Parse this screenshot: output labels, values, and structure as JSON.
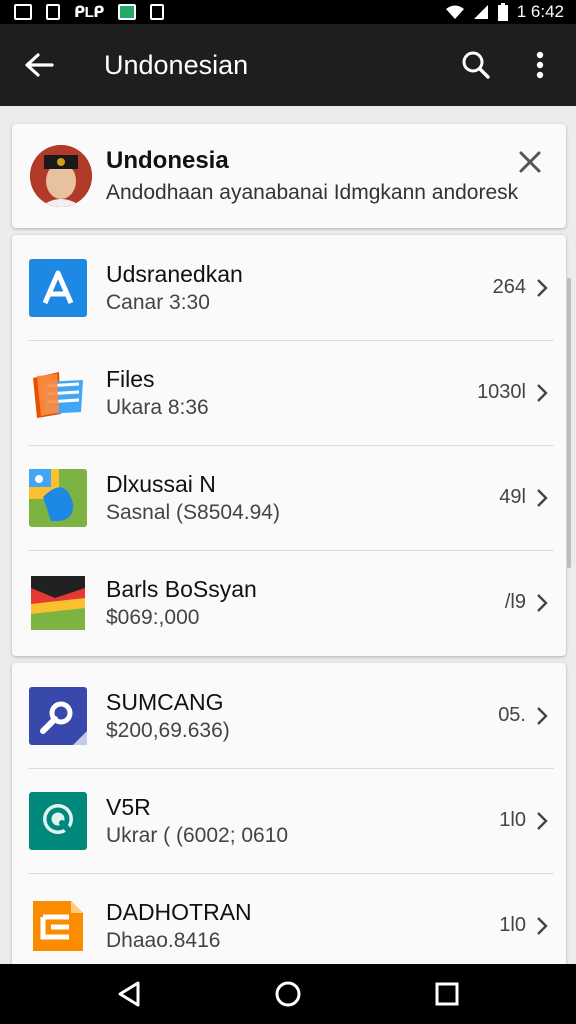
{
  "status_bar": {
    "carrier_text": "ᑭLᑭ",
    "time": "1 6:42"
  },
  "app_bar": {
    "title": "Undonesian"
  },
  "notification": {
    "title": "Undonesia",
    "subtitle": "Andodhaan ayanabanai Idmgkann andoresk"
  },
  "list_1": [
    {
      "icon": "app-store-icon",
      "title": "Udsranedkan",
      "subtitle": "Canar 3:30",
      "value": "264"
    },
    {
      "icon": "files-icon",
      "title": "Files",
      "subtitle": "Ukara 8:36",
      "value": "1030l"
    },
    {
      "icon": "maps-icon",
      "title": "Dlxussai N",
      "subtitle": "Sasnal (S8504.94)",
      "value": "49l"
    },
    {
      "icon": "layers-icon",
      "title": "Barls BoSsyan",
      "subtitle": "$069:,000",
      "value": "/l9"
    }
  ],
  "list_2": [
    {
      "icon": "search-app-icon",
      "title": "SUMCANG",
      "subtitle": "$200,69.636)",
      "value": "05."
    },
    {
      "icon": "q-app-icon",
      "title": "V5R",
      "subtitle": "Ukrar ( (6002; 0610",
      "value": "1l0"
    },
    {
      "icon": "document-app-icon",
      "title": "DADHOTRAN",
      "subtitle": "Dhaao.8416",
      "value": "1l0"
    }
  ],
  "colors": {
    "app_bar": "#1e1e1e",
    "background": "#ececec",
    "card": "#fafafa"
  }
}
